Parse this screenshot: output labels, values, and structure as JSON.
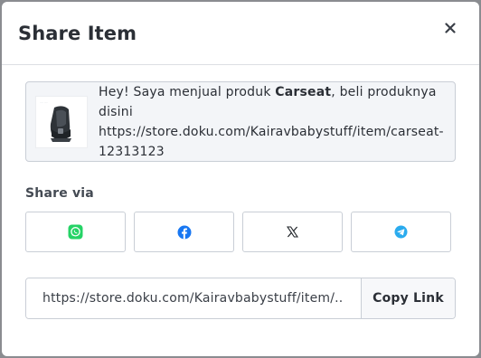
{
  "modal": {
    "title": "Share Item",
    "close_icon": "close-icon"
  },
  "message": {
    "prefix": "Hey! Saya menjual produk ",
    "product_name": "Carseat",
    "suffix": ", beli produknya disini https://store.doku.com/Kairavbabystuff/item/carseat-12313123",
    "thumbnail_icon": "car-seat-product-image"
  },
  "share": {
    "label": "Share via",
    "channels": [
      {
        "name": "WhatsApp",
        "icon": "whatsapp-icon",
        "color": "#25D366"
      },
      {
        "name": "Facebook",
        "icon": "facebook-icon",
        "color": "#1877F2"
      },
      {
        "name": "X",
        "icon": "x-icon",
        "color": "#1f2328"
      },
      {
        "name": "Telegram",
        "icon": "telegram-icon",
        "color": "#2AABEE"
      }
    ]
  },
  "link": {
    "value": "https://store.doku.com/Kairavbabystuff/item/...",
    "copy_label": "Copy Link"
  }
}
